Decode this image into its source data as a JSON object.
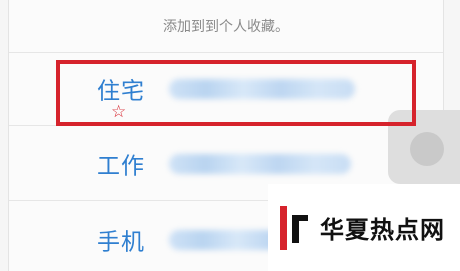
{
  "sheet": {
    "header": "添加到到个人收藏。"
  },
  "rows": [
    {
      "label": "住宅"
    },
    {
      "label": "工作"
    },
    {
      "label": "手机"
    }
  ],
  "annotation": {
    "star": "☆",
    "color": "#d6232c"
  },
  "watermark": {
    "text": "华夏热点网"
  },
  "colors": {
    "label": "#2f7fd0",
    "accent": "#d6232c"
  }
}
